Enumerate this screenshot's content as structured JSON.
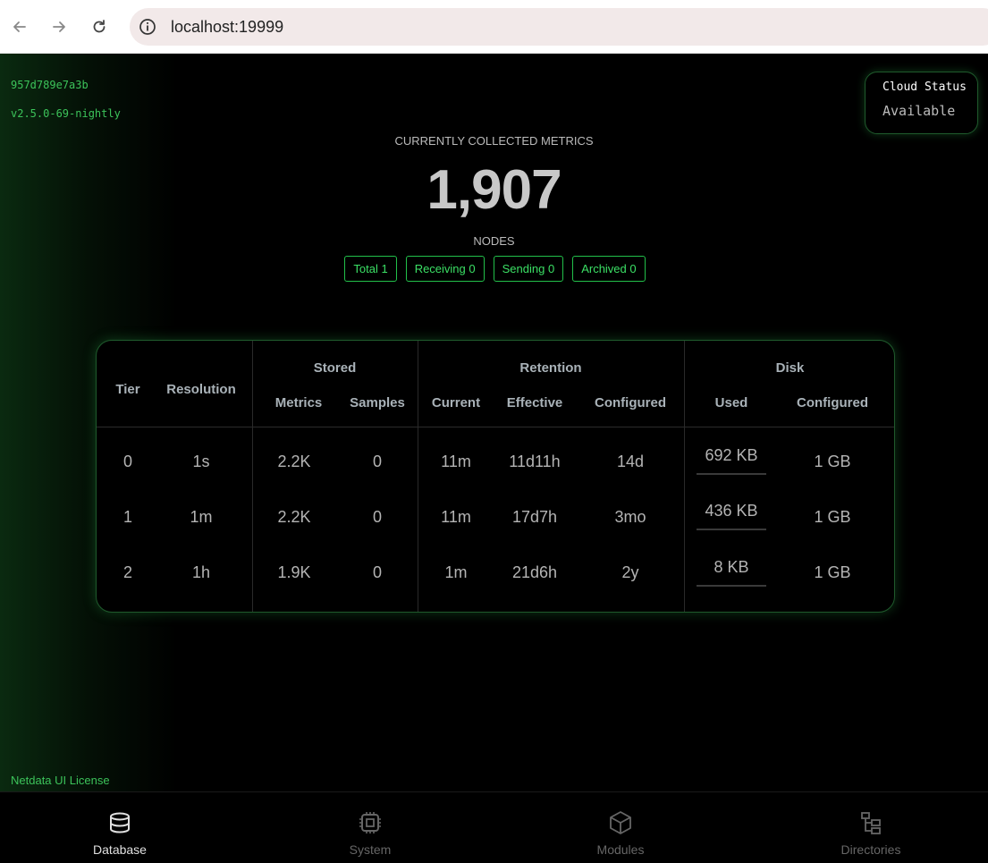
{
  "browser": {
    "url": "localhost:19999",
    "back_icon": "arrow-left-icon",
    "forward_icon": "arrow-right-icon",
    "reload_icon": "reload-icon",
    "info_icon": "info-icon"
  },
  "agent": {
    "id": "957d789e7a3b",
    "version": "v2.5.0-69-nightly"
  },
  "cloud": {
    "title": "Cloud Status",
    "status": "Available"
  },
  "metrics": {
    "label": "CURRENTLY COLLECTED METRICS",
    "count": "1,907"
  },
  "nodes": {
    "label": "NODES",
    "badges": [
      {
        "label": "Total 1"
      },
      {
        "label": "Receiving 0"
      },
      {
        "label": "Sending 0"
      },
      {
        "label": "Archived 0"
      }
    ]
  },
  "table": {
    "headers": {
      "tier": "Tier",
      "resolution": "Resolution",
      "stored": "Stored",
      "retention": "Retention",
      "disk": "Disk",
      "metrics": "Metrics",
      "samples": "Samples",
      "current": "Current",
      "effective": "Effective",
      "configured": "Configured",
      "used": "Used",
      "disk_configured": "Configured"
    },
    "rows": [
      {
        "tier": "0",
        "resolution": "1s",
        "metrics": "2.2K",
        "samples": "0",
        "current": "11m",
        "effective": "11d11h",
        "configured": "14d",
        "used": "692 KB",
        "disk_configured": "1 GB"
      },
      {
        "tier": "1",
        "resolution": "1m",
        "metrics": "2.2K",
        "samples": "0",
        "current": "11m",
        "effective": "17d7h",
        "configured": "3mo",
        "used": "436 KB",
        "disk_configured": "1 GB"
      },
      {
        "tier": "2",
        "resolution": "1h",
        "metrics": "1.9K",
        "samples": "0",
        "current": "1m",
        "effective": "21d6h",
        "configured": "2y",
        "used": "8 KB",
        "disk_configured": "1 GB"
      }
    ]
  },
  "license": "Netdata UI License",
  "bottom_nav": {
    "items": [
      {
        "label": "Database",
        "icon": "database-icon",
        "active": true
      },
      {
        "label": "System",
        "icon": "cpu-icon",
        "active": false
      },
      {
        "label": "Modules",
        "icon": "cube-icon",
        "active": false
      },
      {
        "label": "Directories",
        "icon": "folder-tree-icon",
        "active": false
      }
    ]
  }
}
